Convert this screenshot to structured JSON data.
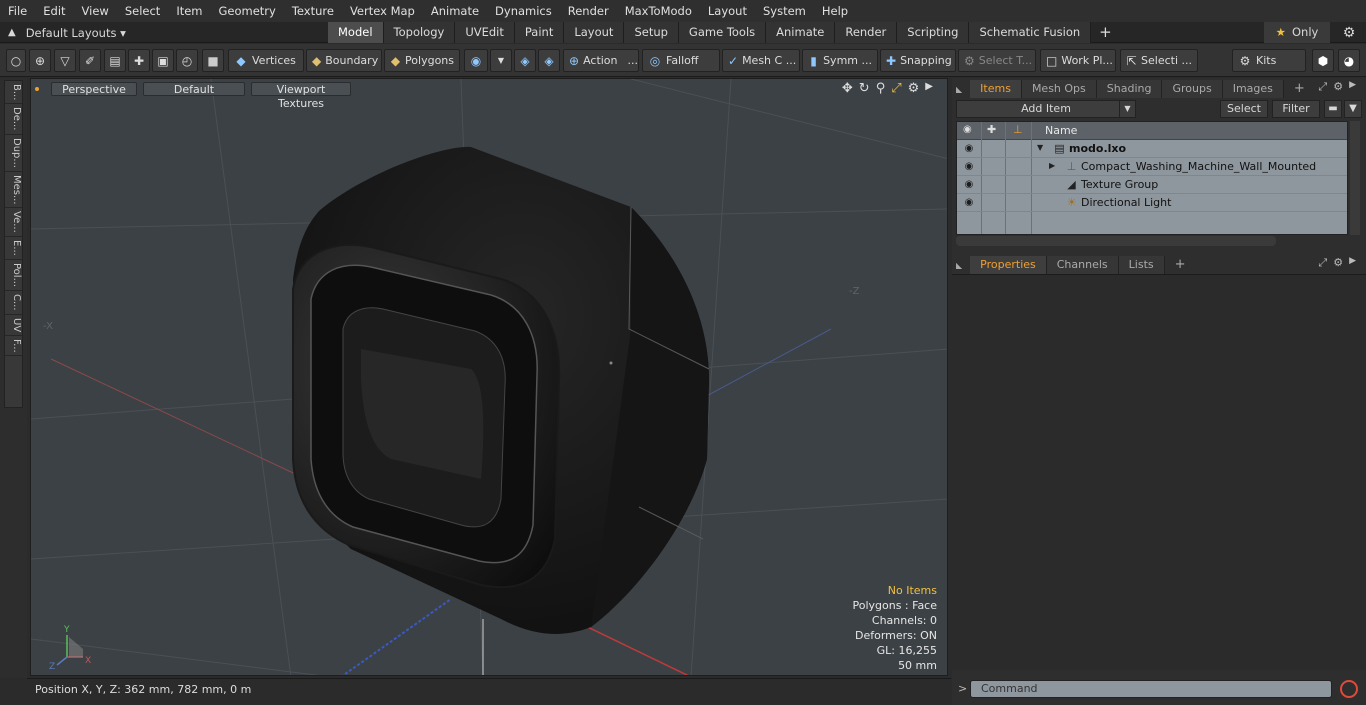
{
  "menu": [
    "File",
    "Edit",
    "View",
    "Select",
    "Item",
    "Geometry",
    "Texture",
    "Vertex Map",
    "Animate",
    "Dynamics",
    "Render",
    "MaxToModo",
    "Layout",
    "System",
    "Help"
  ],
  "layouts": {
    "label": "Default Layouts ▾"
  },
  "tabs": [
    "Model",
    "Topology",
    "UVEdit",
    "Paint",
    "Layout",
    "Setup",
    "Game Tools",
    "Animate",
    "Render",
    "Scripting",
    "Schematic Fusion"
  ],
  "tabs_plus": "+",
  "only_label": "Only",
  "toolbar": {
    "vertices": "Vertices",
    "boundary": "Boundary",
    "polygons": "Polygons",
    "action": "Action",
    "action_more": "...",
    "falloff": "Falloff",
    "meshc": "Mesh C ...",
    "symm": "Symm ...",
    "snapping": "Snapping",
    "selectt": "Select T...",
    "workpl": "Work Pl...",
    "selecti": "Selecti ...",
    "kits": "Kits"
  },
  "left_tabs": [
    "B...",
    "De...",
    "Dup...",
    "Mes...",
    "Ve...",
    "E...",
    "Pol...",
    "C...",
    "UV",
    "F..."
  ],
  "viewport": {
    "perspective": "Perspective",
    "default": "Default",
    "textures": "Viewport Textures",
    "info": {
      "no_items": "No Items",
      "polygons": "Polygons : Face",
      "channels": "Channels: 0",
      "deformers": "Deformers: ON",
      "gl": "GL: 16,255",
      "unit": "50 mm"
    }
  },
  "status": {
    "position": "Position X, Y, Z:   362 mm, 782 mm, 0 m"
  },
  "items_panel": {
    "tabs": [
      "Items",
      "Mesh Ops",
      "Shading",
      "Groups",
      "Images"
    ],
    "add_item": "Add Item",
    "select": "Select",
    "filter": "Filter",
    "header_name": "Name",
    "rows": [
      {
        "label": "modo.lxo"
      },
      {
        "label": "Compact_Washing_Machine_Wall_Mounted"
      },
      {
        "label": "Texture Group"
      },
      {
        "label": "Directional Light"
      }
    ]
  },
  "props_panel": {
    "tabs": [
      "Properties",
      "Channels",
      "Lists"
    ]
  },
  "command": {
    "placeholder": "Command"
  }
}
